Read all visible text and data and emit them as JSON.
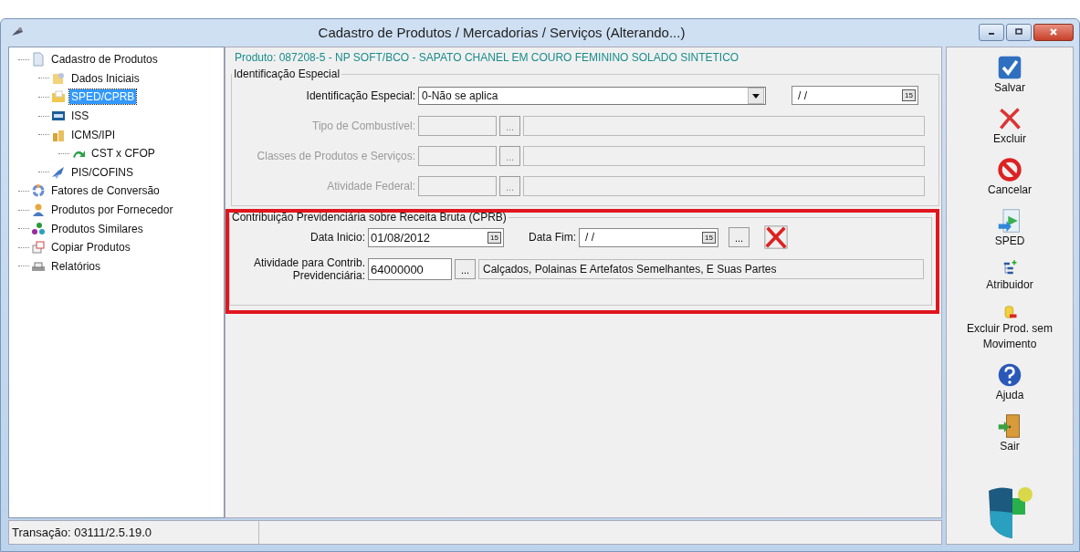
{
  "window": {
    "title": "Cadastro de Produtos / Mercadorias / Serviços (Alterando...)"
  },
  "tree": [
    {
      "label": "Cadastro de Produtos",
      "selected": false,
      "children": [
        {
          "label": "Dados Iniciais",
          "selected": false
        },
        {
          "label": "SPED/CPRB",
          "selected": true
        },
        {
          "label": "ISS",
          "selected": false
        },
        {
          "label": "ICMS/IPI",
          "selected": false,
          "children": [
            {
              "label": "CST x CFOP",
              "selected": false
            }
          ]
        },
        {
          "label": "PIS/COFINS",
          "selected": false
        }
      ]
    },
    {
      "label": "Fatores de Conversão",
      "selected": false
    },
    {
      "label": "Produtos por Fornecedor",
      "selected": false
    },
    {
      "label": "Produtos Similares",
      "selected": false
    },
    {
      "label": "Copiar Produtos",
      "selected": false
    },
    {
      "label": "Relatórios",
      "selected": false
    }
  ],
  "product_line": "Produto: 087208-5 - NP SOFT/BCO - SAPATO CHANEL EM COURO FEMININO SOLADO SINTETICO",
  "special_id_group": {
    "title": "Identificação Especial",
    "rows": [
      {
        "kind": "dropdown",
        "label": "Identificação Especial:",
        "value": "0-Não se aplica",
        "disabled": false,
        "date": {
          "value": "/ /",
          "calendar": "15"
        }
      },
      {
        "kind": "lookup",
        "label": "Tipo de Combustível:",
        "disabled": true,
        "button": "..."
      },
      {
        "kind": "lookup",
        "label": "Classes de Produtos e Serviços:",
        "disabled": true,
        "button": "..."
      },
      {
        "kind": "lookup",
        "label": "Atividade Federal:",
        "disabled": true,
        "button": "..."
      }
    ]
  },
  "cprb_group": {
    "title": "Contribuição Previdenciária sobre Receita Bruta (CPRB)",
    "highlighted": true,
    "start_date": {
      "label": "Data Inicio:",
      "value": "01/08/2012",
      "calendar": "15"
    },
    "end_date": {
      "label": "Data Fim:",
      "value": "/ /",
      "calendar": "15"
    },
    "browse_button": "...",
    "activity": {
      "label": "Atividade para Contrib. Previdenciária:",
      "value": "64000000",
      "button": "...",
      "description": "Calçados, Polainas E Artefatos Semelhantes, E Suas Partes"
    }
  },
  "toolbar": [
    {
      "kind": "save",
      "label": "Salvar"
    },
    {
      "kind": "delete",
      "label": "Excluir"
    },
    {
      "kind": "cancel",
      "label": "Cancelar"
    },
    {
      "kind": "sped",
      "label": "SPED"
    },
    {
      "kind": "tree",
      "label": "Atribuidor"
    },
    {
      "kind": "database",
      "label": "Excluir Prod. sem Movimento"
    },
    {
      "kind": "help",
      "label": "Ajuda"
    },
    {
      "kind": "exit",
      "label": "Sair"
    }
  ],
  "status_bar": [
    "Transação: 03111/2.5.19.0"
  ]
}
